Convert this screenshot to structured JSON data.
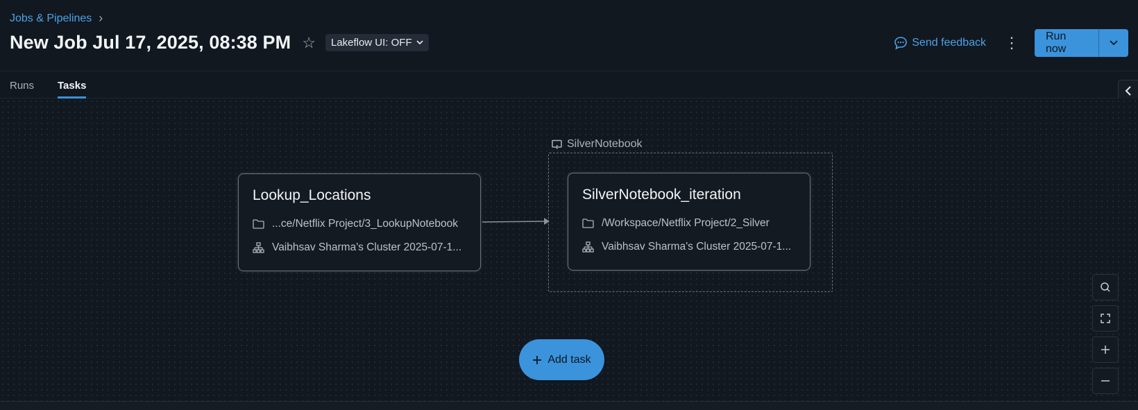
{
  "breadcrumb": {
    "label": "Jobs & Pipelines"
  },
  "header": {
    "title": "New Job Jul 17, 2025, 08:38 PM",
    "lakeflow_label": "Lakeflow UI: OFF",
    "feedback_label": "Send feedback",
    "run_now_label": "Run now"
  },
  "tabs": [
    {
      "label": "Runs",
      "active": false
    },
    {
      "label": "Tasks",
      "active": true
    }
  ],
  "dag": {
    "group_label": "SilverNotebook",
    "tasks": [
      {
        "name": "Lookup_Locations",
        "path": "...ce/Netflix Project/3_LookupNotebook",
        "cluster": "Vaibhsav Sharma's Cluster 2025-07-1..."
      },
      {
        "name": "SilverNotebook_iteration",
        "path": "/Workspace/Netflix Project/2_Silver",
        "cluster": "Vaibhsav Sharma's Cluster 2025-07-1..."
      }
    ],
    "add_task_label": "Add task"
  },
  "colors": {
    "accent": "#3b93dc",
    "link": "#4aa3ea",
    "background": "#111820"
  }
}
